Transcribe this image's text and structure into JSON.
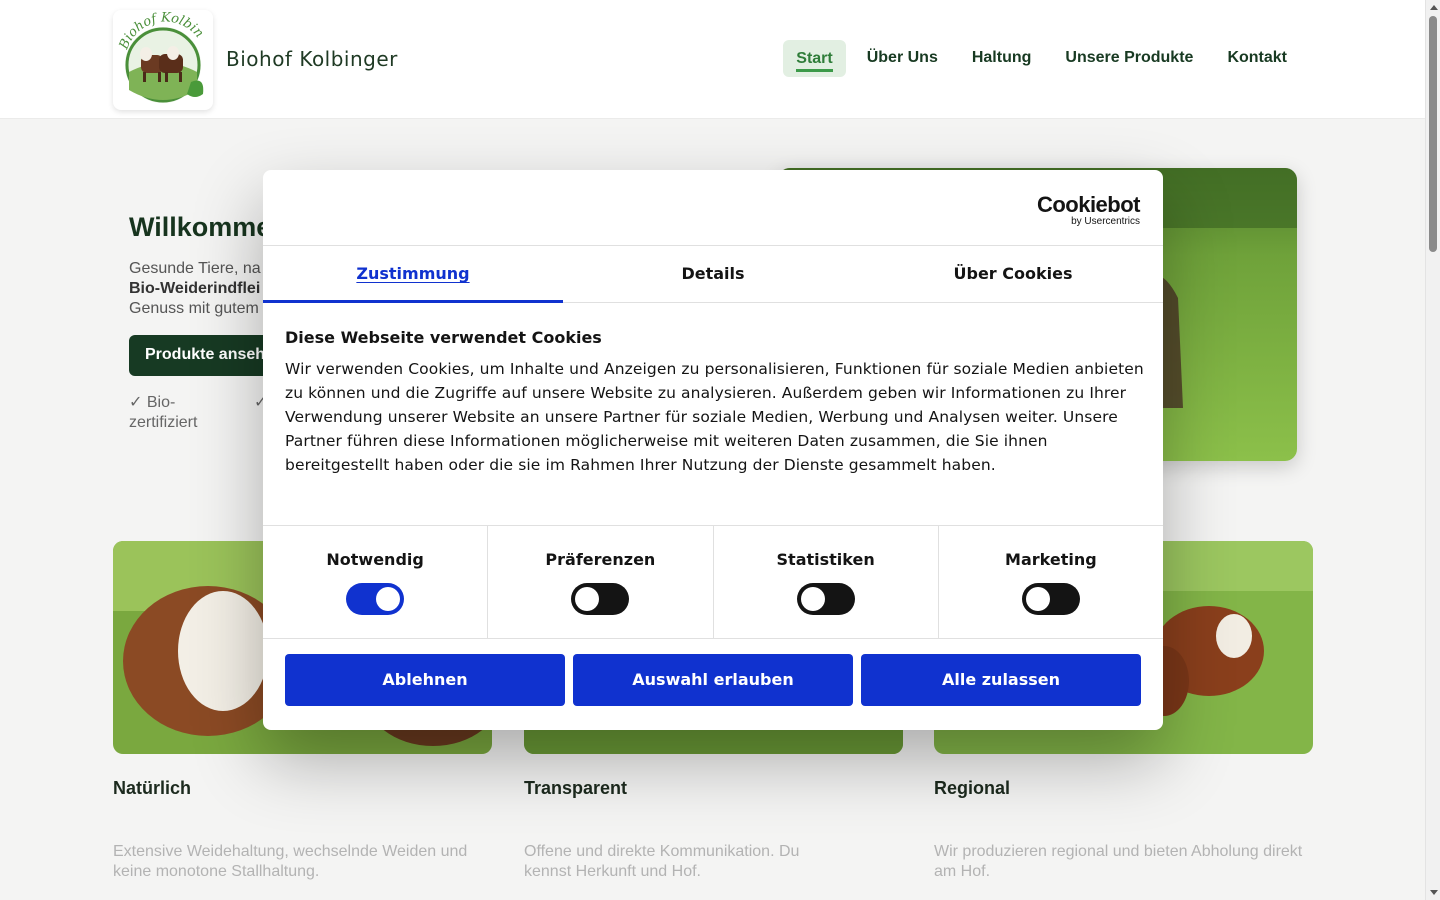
{
  "header": {
    "brand": "Biohof Kolbinger",
    "logo_text": "BIOHOF KOLBINGER",
    "nav": [
      {
        "label": "Start",
        "active": true
      },
      {
        "label": "Über Uns"
      },
      {
        "label": "Haltung"
      },
      {
        "label": "Unsere Produkte"
      },
      {
        "label": "Kontakt"
      }
    ]
  },
  "hero": {
    "title": "Willkommen",
    "text_line1": "Gesunde Tiere, na",
    "text_bold": "Bio-Weiderindflei",
    "text_line3": "Genuss mit gutem",
    "button_label": "Produkte ansehen",
    "checks": [
      "✓ Bio-zertifiziert",
      "✓ B"
    ]
  },
  "cards": [
    {
      "title": "Natürlich",
      "text": "Extensive Weidehaltung, wechselnde Weiden und keine monotone Stallhaltung."
    },
    {
      "title": "Transparent",
      "text": "Offene und direkte Kommunikation. Du kennst Herkunft und Hof."
    },
    {
      "title": "Regional",
      "text": "Wir produzieren regional und bieten Abholung direkt am Hof."
    }
  ],
  "cookie": {
    "brand": "Cookiebot",
    "brand_sub": "by Usercentrics",
    "tabs": [
      {
        "label": "Zustimmung",
        "active": true
      },
      {
        "label": "Details"
      },
      {
        "label": "Über Cookies"
      }
    ],
    "heading": "Diese Webseite verwendet Cookies",
    "body": "Wir verwenden Cookies, um Inhalte und Anzeigen zu personalisieren, Funktionen für soziale Medien anbieten zu können und die Zugriffe auf unsere Website zu analysieren. Außerdem geben wir Informationen zu Ihrer Verwendung unserer Website an unsere Partner für soziale Medien, Werbung und Analysen weiter. Unsere Partner führen diese Informationen möglicherweise mit weiteren Daten zusammen, die Sie ihnen bereitgestellt haben oder die sie im Rahmen Ihrer Nutzung der Dienste gesammelt haben.",
    "toggles": [
      {
        "label": "Notwendig",
        "on": true
      },
      {
        "label": "Präferenzen",
        "on": false
      },
      {
        "label": "Statistiken",
        "on": false
      },
      {
        "label": "Marketing",
        "on": false
      }
    ],
    "buttons": {
      "decline": "Ablehnen",
      "allow_selection": "Auswahl erlauben",
      "allow_all": "Alle zulassen"
    }
  },
  "colors": {
    "accent_blue": "#1032cf",
    "brand_green": "#173a23",
    "nav_active_bg": "#e2efe2"
  }
}
